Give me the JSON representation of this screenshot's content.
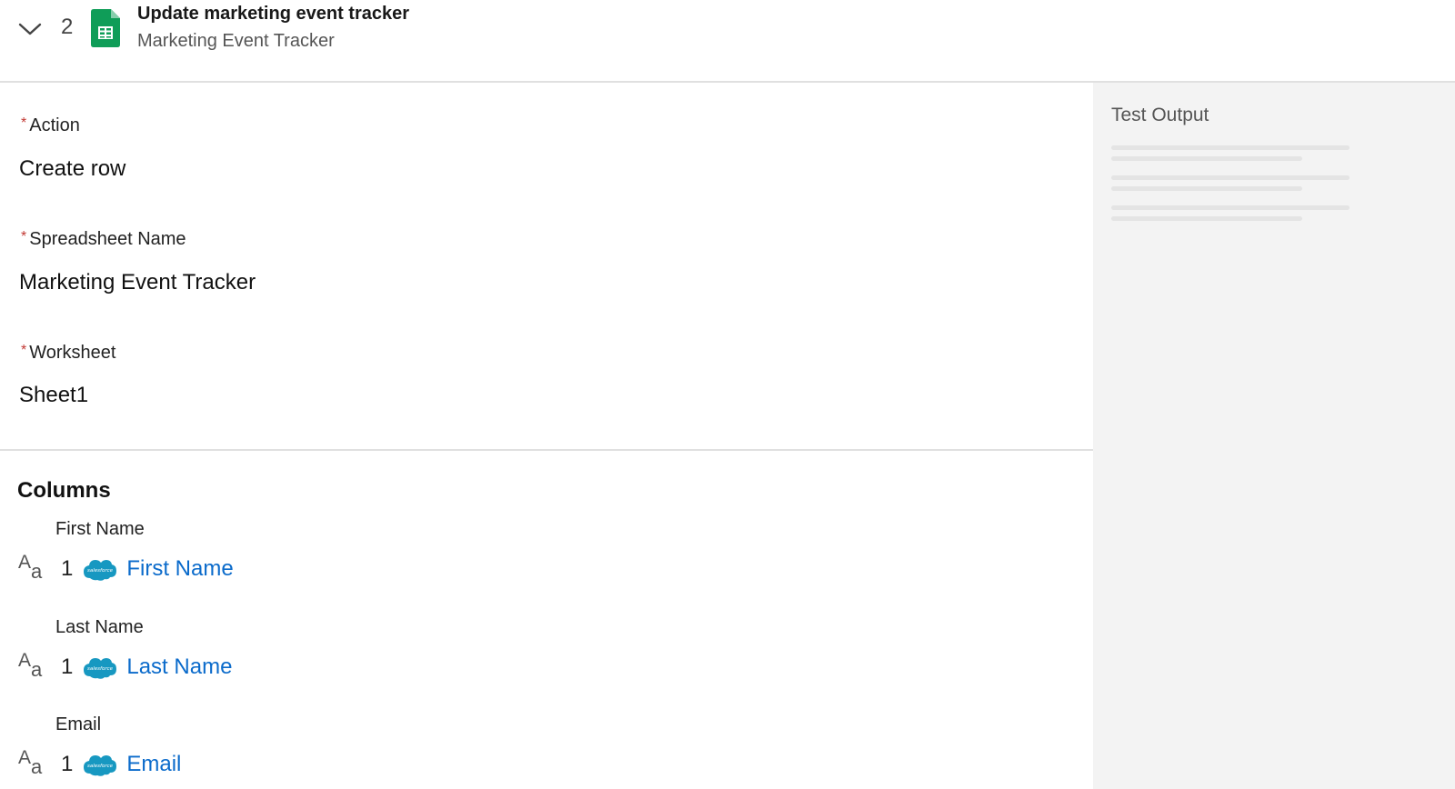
{
  "header": {
    "step_number": "2",
    "title": "Update marketing event tracker",
    "subtitle": "Marketing Event Tracker",
    "chevron_icon": "chevron-down-icon",
    "app_icon": "google-sheets-icon",
    "app_icon_color": "#0f9d58"
  },
  "form": {
    "required_marker": "*",
    "action": {
      "label": "Action",
      "value": "Create row"
    },
    "spreadsheet": {
      "label": "Spreadsheet Name",
      "value": "Marketing Event Tracker"
    },
    "worksheet": {
      "label": "Worksheet",
      "value": "Sheet1"
    }
  },
  "columns": {
    "heading": "Columns",
    "items": [
      {
        "label": "First Name",
        "type_icon": "text-type-icon",
        "type_big": "A",
        "type_small": "a",
        "step": "1",
        "source_icon": "salesforce-icon",
        "source_text": "salesforce",
        "value": "First Name"
      },
      {
        "label": "Last Name",
        "type_icon": "text-type-icon",
        "type_big": "A",
        "type_small": "a",
        "step": "1",
        "source_icon": "salesforce-icon",
        "source_text": "salesforce",
        "value": "Last Name"
      },
      {
        "label": "Email",
        "type_icon": "text-type-icon",
        "type_big": "A",
        "type_small": "a",
        "step": "1",
        "source_icon": "salesforce-icon",
        "source_text": "salesforce",
        "value": "Email"
      }
    ]
  },
  "test_output": {
    "title": "Test Output"
  },
  "colors": {
    "link": "#0b6bcb",
    "required": "#c23934",
    "salesforce_blue": "#1798c1",
    "panel_bg": "#f3f3f3"
  }
}
